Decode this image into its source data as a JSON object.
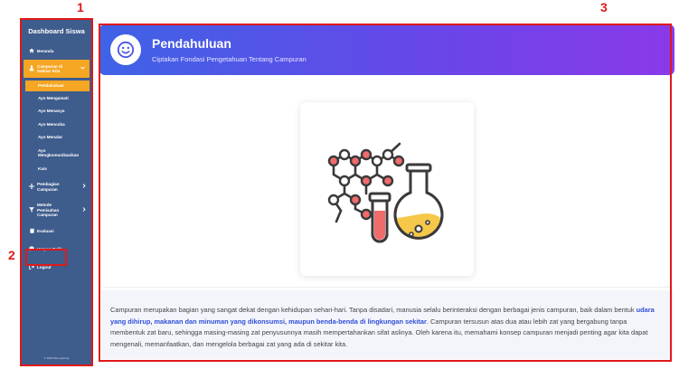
{
  "annotations": {
    "n1": "1",
    "n2": "2",
    "n3": "3"
  },
  "sidebar": {
    "title": "Dashboard Siswa",
    "items": [
      {
        "icon": "home-icon",
        "label": "Beranda"
      },
      {
        "icon": "flask-icon",
        "label": "Campuran di Sekitar Kita"
      },
      {
        "icon": "split-icon",
        "label": "Pembagian Campuran"
      },
      {
        "icon": "filter-icon",
        "label": "Metode Pemisahan Campuran"
      },
      {
        "icon": "clipboard-icon",
        "label": "Evaluasi"
      },
      {
        "icon": "comment-icon",
        "label": "Umpan Balik"
      },
      {
        "icon": "logout-icon",
        "label": "Logout"
      }
    ],
    "subitems": [
      "Pendahuluan",
      "Ayo Mengamati",
      "Ayo Menanya",
      "Ayo Mencoba",
      "Ayo Menalar",
      "Ayo Mengkomunikasikan",
      "Kuis"
    ],
    "footer": "© 2025 IPA Learning"
  },
  "header": {
    "title": "Pendahuluan",
    "subtitle": "Ciptakan Fondasi Pengetahuan Tentang Campuran"
  },
  "content": {
    "para_part1": "Campuran merupakan bagian yang sangat dekat dengan kehidupan sehari-hari. Tanpa disadari, manusia selalu berinteraksi dengan berbagai jenis campuran, baik dalam bentuk ",
    "para_highlight": "udara yang dihirup, makanan dan minuman yang dikonsumsi, maupun benda-benda di lingkungan sekitar",
    "para_part2": ". Campuran tersusun atas dua atau lebih zat yang bergabung tanpa membentuk zat baru, sehingga masing-masing zat penyusunnya masih mempertahankan sifat aslinya. Oleh karena itu, memahami konsep campuran menjadi penting agar kita dapat mengenali, memanfaatkan, dan mengelola berbagai zat yang ada di sekitar kita."
  },
  "colors": {
    "sidebar": "#3e5c8c",
    "accent": "#f5a623",
    "highlight": "#2f4fd8",
    "annotation": "#e01919"
  }
}
